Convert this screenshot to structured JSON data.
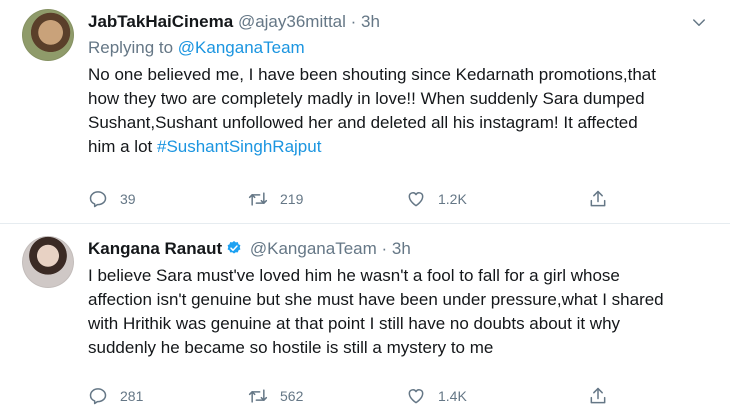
{
  "tweets": [
    {
      "name": "JabTakHaiCinema",
      "handle": "@ajay36mittal",
      "separator": "·",
      "time": "3h",
      "replying_prefix": "Replying to",
      "replying_to": "@KanganaTeam",
      "lines": [
        "No one believed me, I have been shouting since Kedarnath promotions,that",
        "how they two are completely madly in love!! When suddenly Sara dumped",
        "Sushant,Sushant unfollowed her and deleted all his instagram! It affected",
        "him a lot "
      ],
      "hashtag": "#SushantSinghRajput",
      "replies": "39",
      "retweets": "219",
      "likes": "1.2K"
    },
    {
      "name": "Kangana Ranaut",
      "verified": true,
      "handle": "@KanganaTeam",
      "separator": "·",
      "time": "3h",
      "lines": [
        "I believe Sara must've loved him he wasn't a fool to fall for a girl whose",
        "affection isn't genuine but she must have been under pressure,what I shared",
        "with Hrithik was genuine at that point I still have no doubts about it why",
        "suddenly he became so hostile is still a mystery to me"
      ],
      "replies": "281",
      "retweets": "562",
      "likes": "1.4K"
    }
  ],
  "icons": {
    "reply": "reply-icon",
    "retweet": "retweet-icon",
    "like": "heart-icon",
    "share": "share-icon",
    "caret": "chevron-down-icon",
    "verified": "verified-badge-icon"
  },
  "colors": {
    "link": "#1b95e0",
    "muted": "#657786",
    "text": "#14171a",
    "verified": "#1da1f2"
  }
}
